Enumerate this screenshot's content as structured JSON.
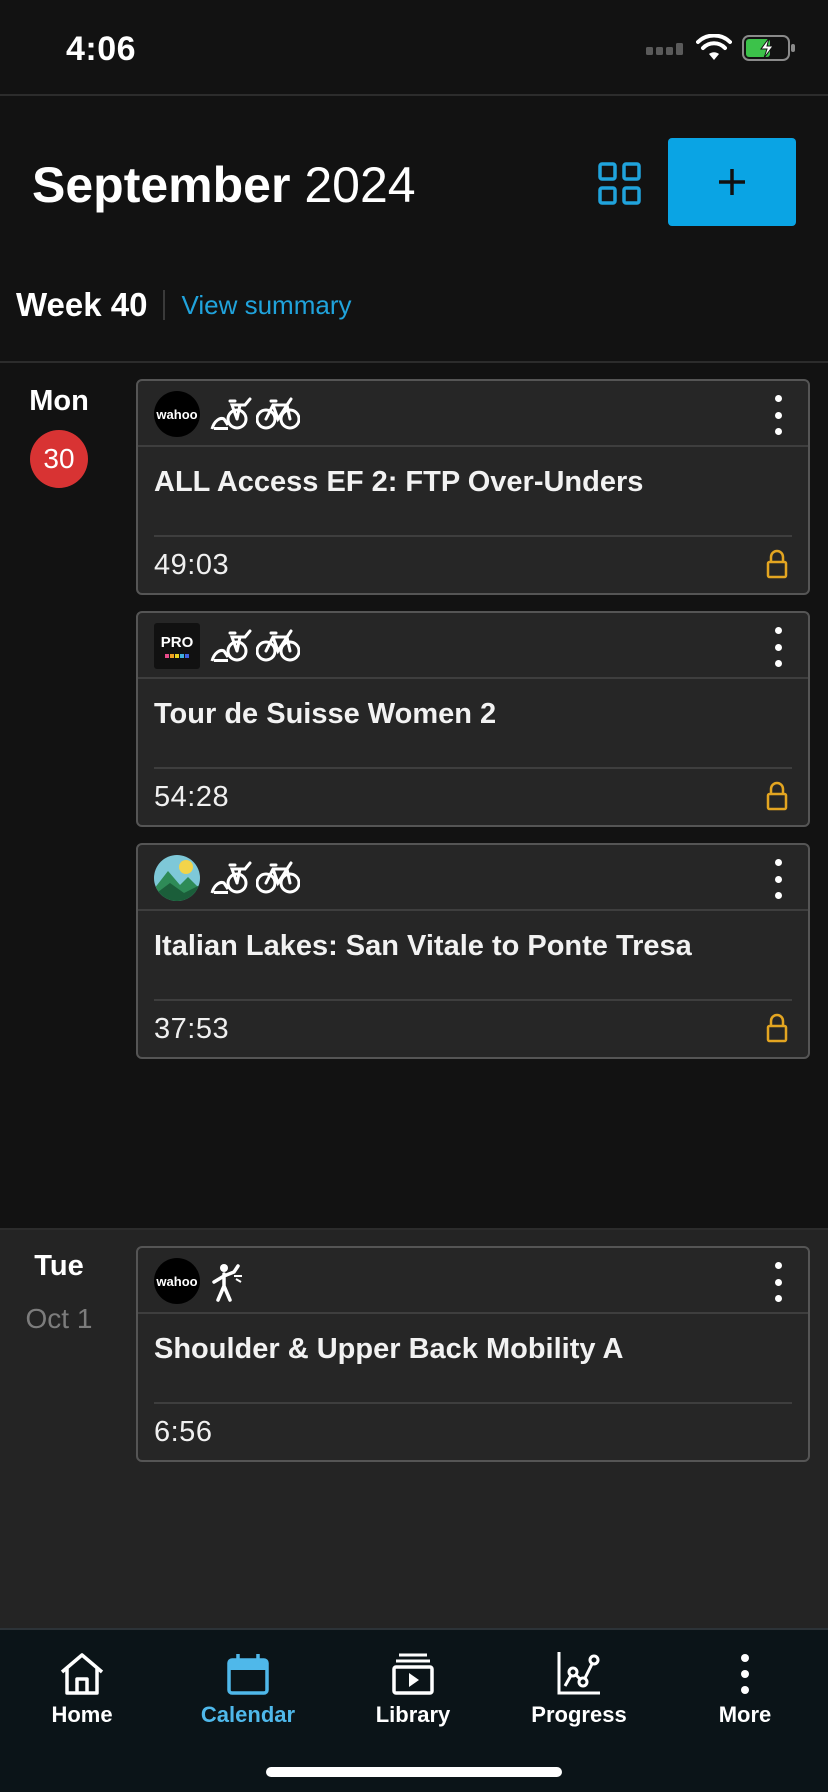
{
  "status": {
    "time": "4:06"
  },
  "header": {
    "month": "September",
    "year": "2024",
    "week_label": "Week 40",
    "view_summary": "View summary",
    "add_label": "+"
  },
  "days": [
    {
      "name": "Mon",
      "date": "30",
      "is_today": true,
      "workouts": [
        {
          "logo": "wahoo",
          "logo_text": "wahoo",
          "sports": [
            "indoor-cycling-icon",
            "outdoor-cycling-icon"
          ],
          "title": "ALL Access EF 2: FTP Over-Unders",
          "duration": "49:03",
          "locked": true
        },
        {
          "logo": "pro",
          "logo_text": "PRO",
          "sports": [
            "indoor-cycling-icon",
            "outdoor-cycling-icon"
          ],
          "title": "Tour de Suisse Women 2",
          "duration": "54:28",
          "locked": true
        },
        {
          "logo": "mountain",
          "sports": [
            "indoor-cycling-icon",
            "outdoor-cycling-icon"
          ],
          "title": "Italian Lakes: San Vitale to Ponte Tresa",
          "duration": "37:53",
          "locked": true
        }
      ]
    },
    {
      "name": "Tue",
      "date": "Oct 1",
      "is_today": false,
      "workouts": [
        {
          "logo": "wahoo",
          "logo_text": "wahoo",
          "sports": [
            "mobility-icon"
          ],
          "title": "Shoulder & Upper Back Mobility A",
          "duration": "6:56",
          "locked": false
        }
      ]
    }
  ],
  "nav": [
    {
      "label": "Home",
      "icon": "home-icon",
      "active": false
    },
    {
      "label": "Calendar",
      "icon": "calendar-icon",
      "active": true
    },
    {
      "label": "Library",
      "icon": "library-icon",
      "active": false
    },
    {
      "label": "Progress",
      "icon": "progress-icon",
      "active": false
    },
    {
      "label": "More",
      "icon": "more-icon",
      "active": false
    }
  ],
  "colors": {
    "accent": "#0aa4e4",
    "today_badge": "#d83333",
    "lock": "#e3a521",
    "battery": "#3cc24a"
  }
}
